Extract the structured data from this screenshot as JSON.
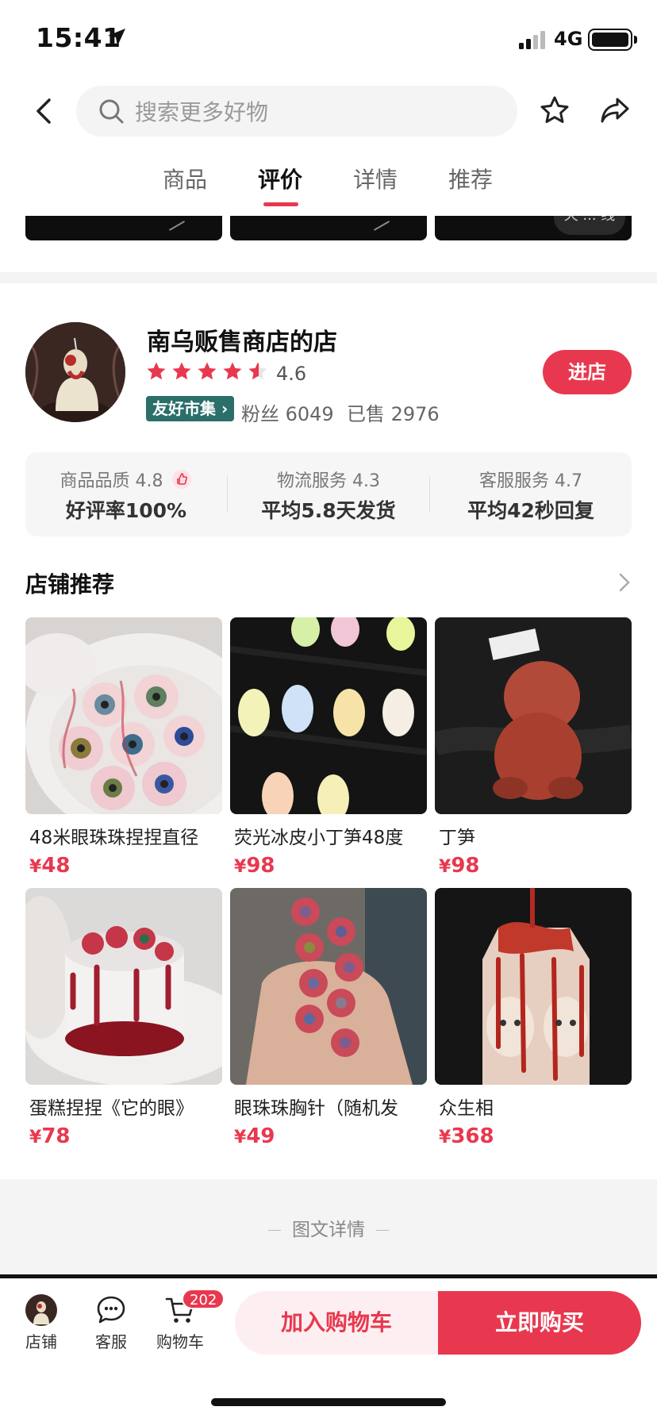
{
  "status_bar": {
    "time": "15:41",
    "network": "4G"
  },
  "search": {
    "placeholder": "搜索更多好物"
  },
  "tabs": [
    {
      "label": "商品"
    },
    {
      "label": "评价",
      "active": true
    },
    {
      "label": "详情"
    },
    {
      "label": "推荐"
    }
  ],
  "strip": {
    "badge": "天 ... 线"
  },
  "shop": {
    "name": "南乌贩售商店的店",
    "rating": "4.6",
    "rating_fraction": 0.92,
    "market_badge": "友好市集",
    "fans": "粉丝 6049",
    "sold": "已售 2976",
    "enter_label": "进店"
  },
  "metrics": [
    {
      "title": "商品品质 4.8",
      "value": "好评率100%"
    },
    {
      "title": "物流服务 4.3",
      "value": "平均5.8天发货"
    },
    {
      "title": "客服服务 4.7",
      "value": "平均42秒回复"
    }
  ],
  "recommend": {
    "title": "店铺推荐",
    "products": [
      {
        "name": "48米眼珠珠捏捏直径",
        "price": "48"
      },
      {
        "name": "荧光冰皮小丁笋48度",
        "price": "98"
      },
      {
        "name": "丁笋",
        "price": "98"
      },
      {
        "name": "蛋糕捏捏《它的眼》",
        "price": "78"
      },
      {
        "name": "眼珠珠胸针（随机发",
        "price": "49"
      },
      {
        "name": "众生相",
        "price": "368"
      }
    ]
  },
  "detail": {
    "label": "图文详情"
  },
  "bottom_bar": {
    "store_label": "店铺",
    "service_label": "客服",
    "cart_label": "购物车",
    "cart_count": "202",
    "add_cart_label": "加入购物车",
    "buy_now_label": "立即购买"
  },
  "colors": {
    "accent": "#e8384f",
    "badge_green": "#2b6e6a"
  }
}
